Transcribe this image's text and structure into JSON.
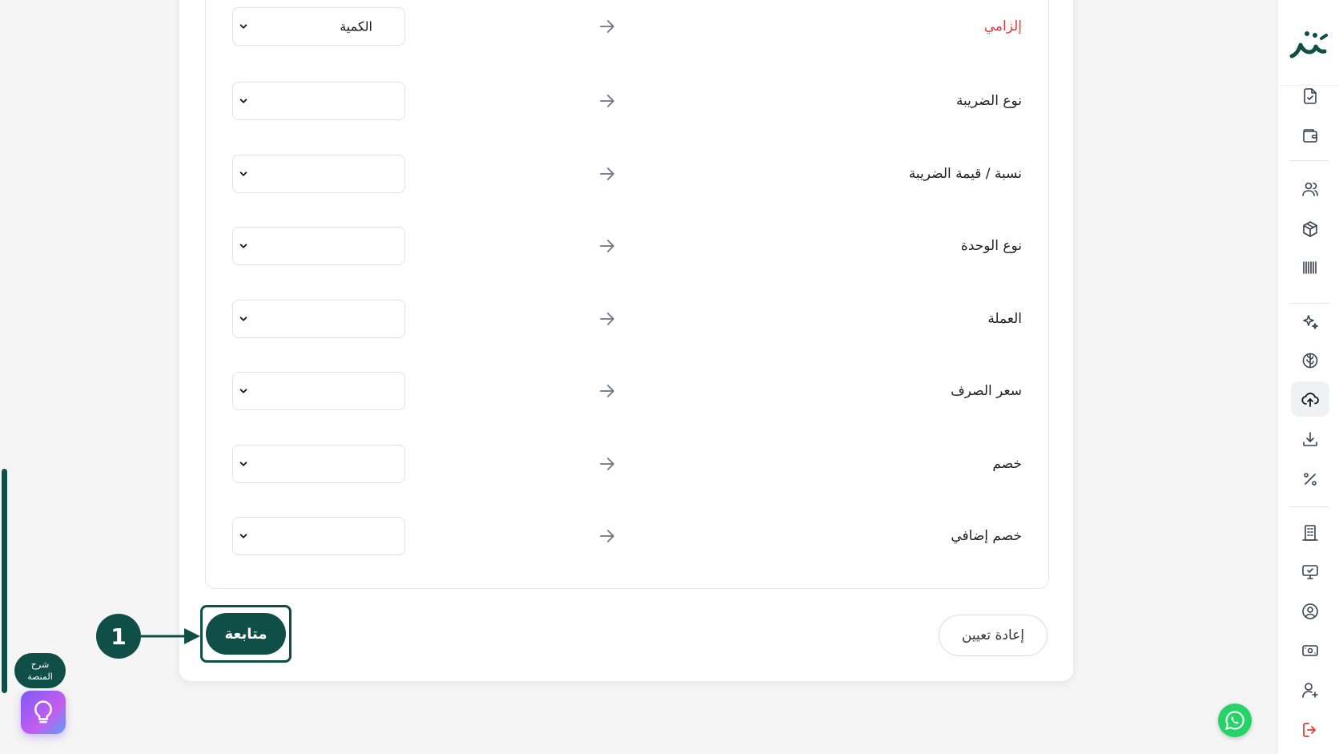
{
  "mapping": {
    "rows": [
      {
        "label": "إلزامي",
        "required": true,
        "selected": "الكمية"
      },
      {
        "label": "نوع الضريبة",
        "required": false,
        "selected": ""
      },
      {
        "label": "نسبة / قيمة الضريبة",
        "required": false,
        "selected": ""
      },
      {
        "label": "نوع الوحدة",
        "required": false,
        "selected": ""
      },
      {
        "label": "العملة",
        "required": false,
        "selected": ""
      },
      {
        "label": "سعر الصرف",
        "required": false,
        "selected": ""
      },
      {
        "label": "خصم",
        "required": false,
        "selected": ""
      },
      {
        "label": "خصم إضافي",
        "required": false,
        "selected": ""
      }
    ]
  },
  "footer": {
    "continue_label": "متابعة",
    "reset_label": "إعادة تعيين"
  },
  "tutorial": {
    "step_number": "1"
  },
  "help": {
    "label": "شرح المنصة"
  },
  "colors": {
    "brand": "#0f4f47",
    "required": "#e53935",
    "whatsapp": "#25d366",
    "logout": "#e53935"
  },
  "sidebar": {
    "icons": [
      "document-check-icon",
      "wallet-icon",
      "users-icon",
      "package-box-icon",
      "barcode-icon",
      "sparkles-icon",
      "brain-icon",
      "cloud-upload-icon",
      "download-icon",
      "percent-icon",
      "building-icon",
      "monitor-check-icon",
      "user-circle-icon",
      "cash-icon",
      "user-plus-icon",
      "logout-icon"
    ],
    "active": "cloud-upload-icon"
  }
}
